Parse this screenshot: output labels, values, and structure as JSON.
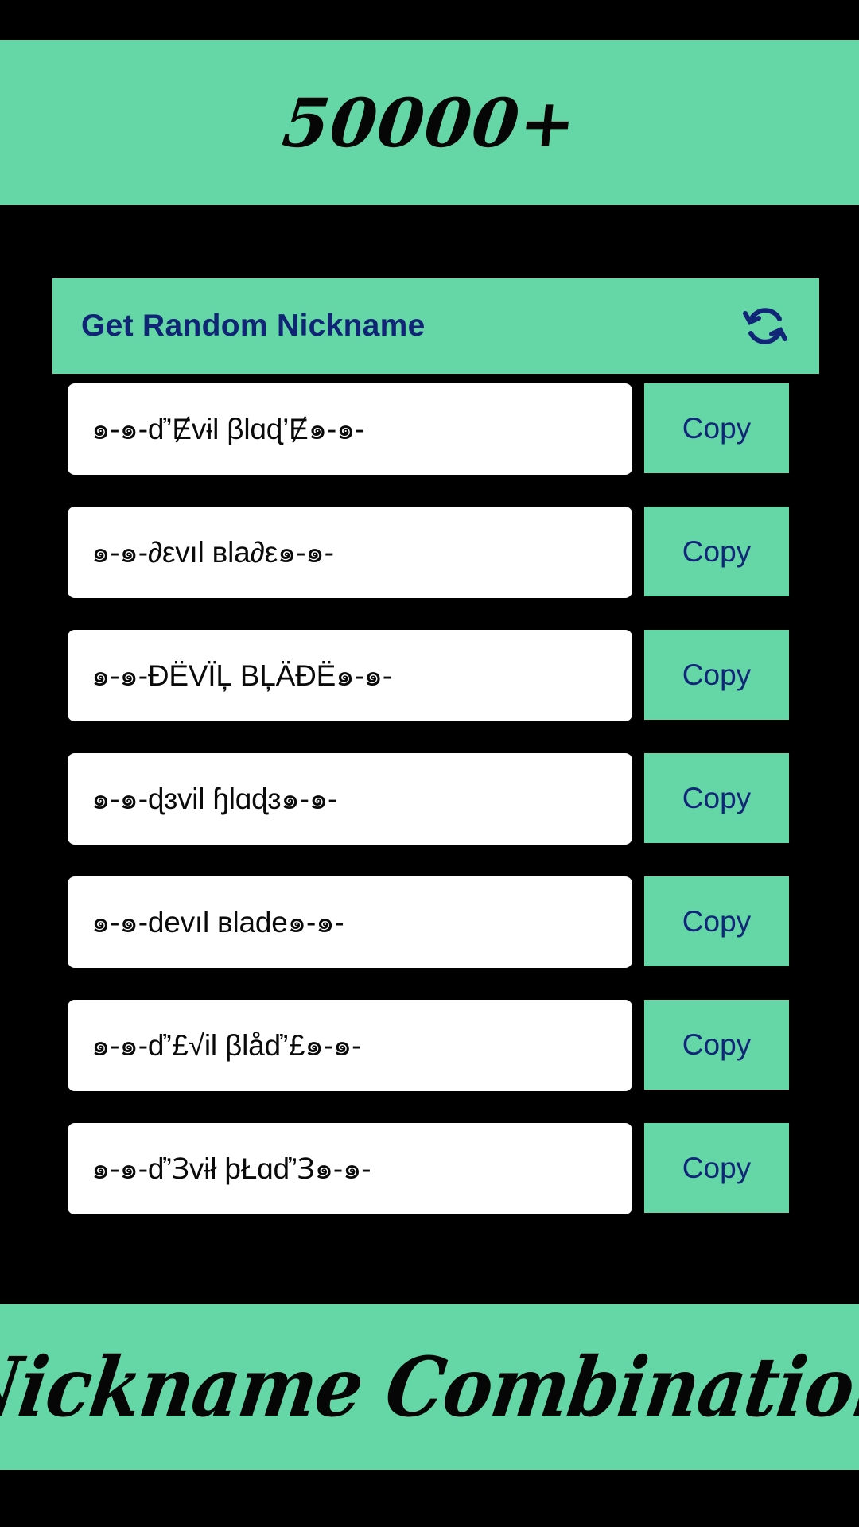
{
  "header": {
    "title": "50000+",
    "banner_color": "#65D6A5"
  },
  "random_bar": {
    "label": "Get Random Nickname",
    "icon": "refresh-icon",
    "background_color": "#65D6A5",
    "text_color": "#112577"
  },
  "nicknames": [
    {
      "text": "๑-๑-ď’Ɇvɨl βlɑɖ’Ɇ๑-๑-",
      "copy_label": "Copy"
    },
    {
      "text": "๑-๑-∂εvıl вla∂ε๑-๑-",
      "copy_label": "Copy"
    },
    {
      "text": "๑-๑-ĐËVÏĻ BĻÄĐË๑-๑-",
      "copy_label": "Copy"
    },
    {
      "text": "๑-๑-ɖɜvil ɧlɑɖɜ๑-๑-",
      "copy_label": "Copy"
    },
    {
      "text": "๑-๑-devıl вlade๑-๑-",
      "copy_label": "Copy"
    },
    {
      "text": "๑-๑-ď’£√il βlåď’£๑-๑-",
      "copy_label": "Copy"
    },
    {
      "text": "๑-๑-ď’Ɜvɨł þŁɑď’Ɜ๑-๑-",
      "copy_label": "Copy"
    }
  ],
  "footer": {
    "title": "Nickname Combination",
    "banner_color": "#65D6A5"
  },
  "colors": {
    "page_background": "#000000",
    "accent_green": "#65D6A5",
    "navy_text": "#122679",
    "card_white": "#FFFFFF"
  }
}
